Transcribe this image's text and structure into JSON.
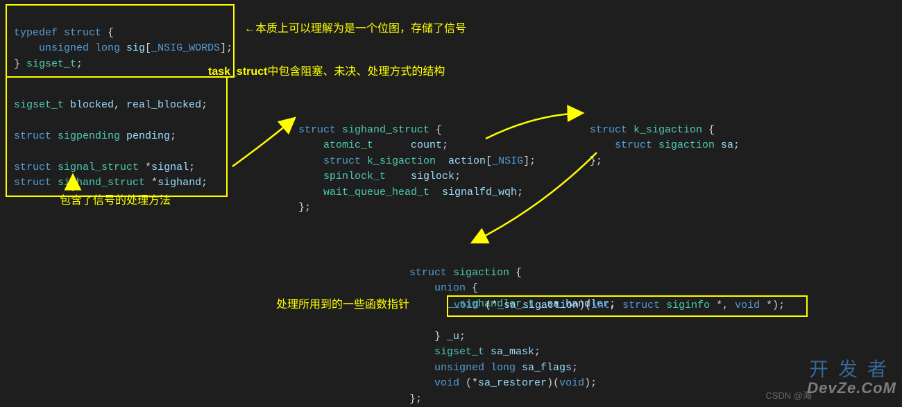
{
  "colors": {
    "highlight": "#ffff00",
    "keyword": "#569cd6",
    "type": "#4ec9b0",
    "var": "#9cdcfe",
    "bg": "#1e1e1e"
  },
  "box1": {
    "l1_a": "typedef",
    "l1_b": " struct",
    "l1_c": " {",
    "l2_a": "    unsigned long",
    "l2_b": " sig",
    "l2_c": "[",
    "l2_d": "_NSIG_WORDS",
    "l2_e": "];",
    "l3_a": "} ",
    "l3_b": "sigset_t",
    "l3_c": ";"
  },
  "anno1": "←本质上可以理解为是一个位图，存储了信号",
  "anno2_a": "task_struct",
  "anno2_b": "中包含阻塞、未决、处理方式的结构",
  "box2": {
    "l1_a": "sigset_t",
    "l1_b": " blocked",
    "l1_c": ", ",
    "l1_d": "real_blocked",
    "l1_e": ";",
    "l2_a": "struct",
    "l2_b": " sigpending",
    "l2_c": " pending",
    "l2_d": ";",
    "l3_a": "struct",
    "l3_b": " signal_struct",
    "l3_c": " *",
    "l3_d": "signal",
    "l3_e": ";",
    "l4_a": "struct",
    "l4_b": " sighand_struct",
    "l4_c": " *",
    "l4_d": "sighand",
    "l4_e": ";"
  },
  "anno3": "包含了信号的处理方法",
  "sighand": {
    "l1_a": "struct",
    "l1_b": " sighand_struct",
    "l1_c": " {",
    "l2_a": "    atomic_t",
    "l2_b": "      count",
    "l2_c": ";",
    "l3_a": "    struct",
    "l3_b": " k_sigaction",
    "l3_c": "  action",
    "l3_d": "[",
    "l3_e": "_NSIG",
    "l3_f": "];",
    "l4_a": "    spinlock_t",
    "l4_b": "    siglock",
    "l4_c": ";",
    "l5_a": "    wait_queue_head_t",
    "l5_b": "  signalfd_wqh",
    "l5_c": ";",
    "l6_a": "};"
  },
  "ksig": {
    "l1_a": "struct",
    "l1_b": " k_sigaction",
    "l1_c": " {",
    "l2_a": "    struct",
    "l2_b": " sigaction",
    "l2_c": " sa",
    "l2_d": ";",
    "l3_a": "};"
  },
  "sigact": {
    "l1_a": "struct",
    "l1_b": " sigaction",
    "l1_c": " {",
    "l2_a": "    union",
    "l2_b": " {",
    "l3_a": "      __sighandler_t",
    "l3_b": " _sa_handler",
    "l3_c": ";",
    "boxed_a": "void",
    "boxed_b": " (*",
    "boxed_c": "_sa_sigaction",
    "boxed_d": ")(",
    "boxed_e": "int",
    "boxed_f": ", ",
    "boxed_g": "struct",
    "boxed_h": " siginfo",
    "boxed_i": " *, ",
    "boxed_j": "void",
    "boxed_k": " *);",
    "l5_a": "    } ",
    "l5_b": "_u",
    "l5_c": ";",
    "l6_a": "    sigset_t",
    "l6_b": " sa_mask",
    "l6_c": ";",
    "l7_a": "    unsigned long",
    "l7_b": " sa_flags",
    "l7_c": ";",
    "l8_a": "    void",
    "l8_b": " (*",
    "l8_c": "sa_restorer",
    "l8_d": ")(",
    "l8_e": "void",
    "l8_f": ");",
    "l9_a": "};"
  },
  "anno4": "处理所用到的一些函数指针",
  "watermark": {
    "cn": "开发者",
    "en": "DevZe.CoM",
    "csdn": "CSDN @海"
  }
}
